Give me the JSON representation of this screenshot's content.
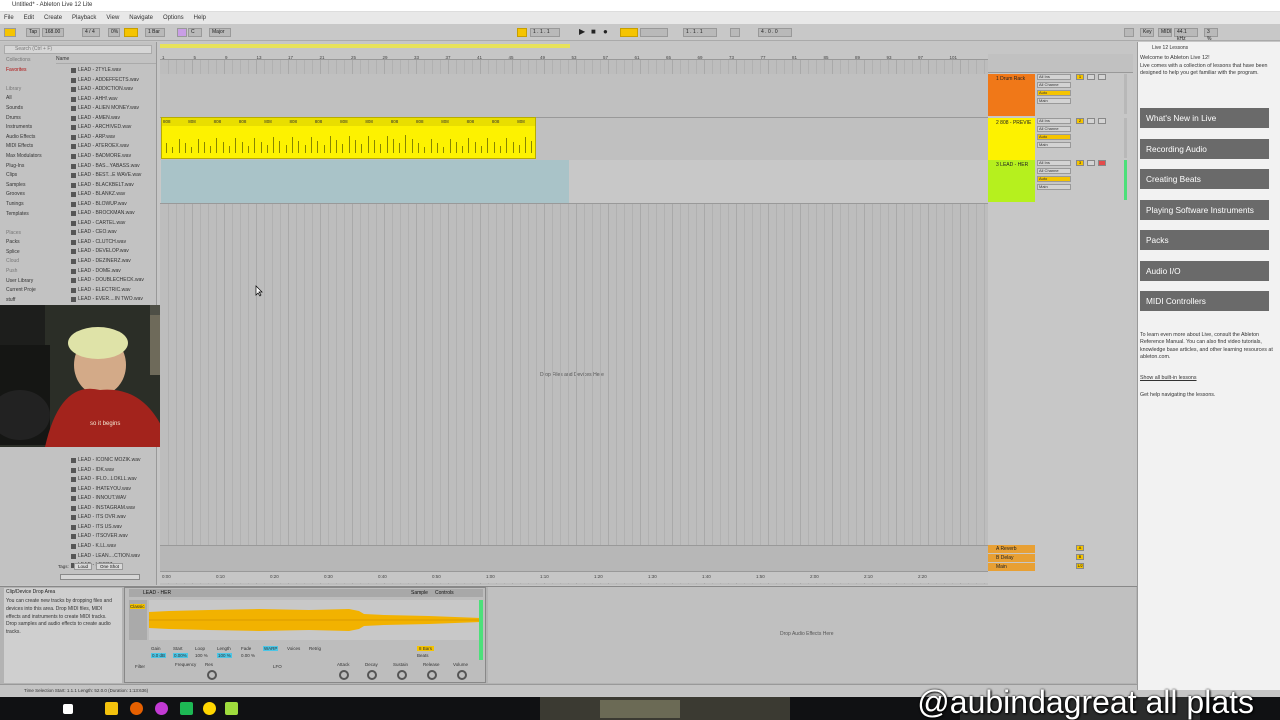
{
  "window": {
    "title": "Untitled* - Ableton Live 12 Lite",
    "min": "–",
    "max": "☐",
    "close": "✕"
  },
  "menu": [
    "File",
    "Edit",
    "Create",
    "Playback",
    "View",
    "Navigate",
    "Options",
    "Help"
  ],
  "toolbar": {
    "tap": "Tap",
    "tempo": "168.00",
    "sig": "4 / 4",
    "metro": "0%",
    "quant": "1 Bar",
    "key": "C",
    "scale": "Major",
    "pos": "1 . 1 . 1",
    "loop_start": "1 . 1 . 1",
    "loop_len": "4 . 0 . 0",
    "cpu": "3 %",
    "sample_rate": "44.1 kHz",
    "keyLabel": "Key",
    "midiLabel": "MIDI"
  },
  "browser": {
    "search_placeholder": "Search (Ctrl + F)",
    "name_header": "Name",
    "places": [
      {
        "label": "Collections",
        "type": "hdr"
      },
      {
        "label": "Favorites",
        "type": "fav"
      },
      {
        "label": "",
        "type": "sp"
      },
      {
        "label": "Library",
        "type": "hdr"
      },
      {
        "label": "All",
        "type": "n"
      },
      {
        "label": "Sounds",
        "type": "n"
      },
      {
        "label": "Drums",
        "type": "n"
      },
      {
        "label": "Instruments",
        "type": "n"
      },
      {
        "label": "Audio Effects",
        "type": "n"
      },
      {
        "label": "MIDI Effects",
        "type": "n"
      },
      {
        "label": "Max Modulators",
        "type": "n"
      },
      {
        "label": "Plug-Ins",
        "type": "n"
      },
      {
        "label": "Clips",
        "type": "n"
      },
      {
        "label": "Samples",
        "type": "n"
      },
      {
        "label": "Grooves",
        "type": "n"
      },
      {
        "label": "Tunings",
        "type": "n"
      },
      {
        "label": "Templates",
        "type": "n"
      },
      {
        "label": "",
        "type": "sp"
      },
      {
        "label": "Places",
        "type": "hdr"
      },
      {
        "label": "Packs",
        "type": "n"
      },
      {
        "label": "Splice",
        "type": "n"
      },
      {
        "label": "Cloud",
        "type": "hdr"
      },
      {
        "label": "Push",
        "type": "hdr"
      },
      {
        "label": "User Library",
        "type": "n"
      },
      {
        "label": "Current Proje",
        "type": "n"
      },
      {
        "label": "stuff",
        "type": "n"
      }
    ],
    "files_top": [
      "LEAD - 2TYLE.wav",
      "LEAD - ADDEFFECTS.wav",
      "LEAD - ADDICTION.wav",
      "LEAD - AHH!.wav",
      "LEAD - ALIEN MONEY.wav",
      "LEAD - AMEN.wav",
      "LEAD - ARCHIVED.wav",
      "LEAD - ARP.wav",
      "LEAD - ATEROEX.wav",
      "LEAD - BADMORE.wav",
      "LEAD - BAS...YABASS.wav",
      "LEAD - BEST...E WAVE.wav",
      "LEAD - BLACKBELT.wav",
      "LEAD - BLANKZ.wav",
      "LEAD - BLOWUP.wav",
      "LEAD - BROCKMAN.wav",
      "LEAD - CARTEL.wav",
      "LEAD - CEO.wav",
      "LEAD - CLUTCH.wav",
      "LEAD - DEVELOP.wav",
      "LEAD - DEZINERZ.wav",
      "LEAD - DOME.wav",
      "LEAD - DOUBLECHECK.wav",
      "LEAD - ELECTRIC.wav",
      "LEAD - EVER....IN TWO.wav"
    ],
    "files_bottom": [
      "LEAD - ICONIC MOZIK.wav",
      "LEAD - IDK.wav",
      "LEAD - IFLO...LOKLL.wav",
      "LEAD - IHATEYOU.wav",
      "LEAD - INNOUT.WAV",
      "LEAD - INSTAGRAM.wav",
      "LEAD - ITS OVR.wav",
      "LEAD - ITS US.wav",
      "LEAD - ITSOVER.wav",
      "LEAD - K.LL.wav",
      "LEAD - LEAN....CTION.wav",
      "LEAD - LOOPZ.wav"
    ],
    "tags_label": "Tags:",
    "tag1": "Loud",
    "tag2": "One Shot"
  },
  "webcam": {
    "shirt_text": "so it begins"
  },
  "arrangement": {
    "ruler_ticks": [
      "1",
      "5",
      "9",
      "13",
      "17",
      "21",
      "25",
      "29",
      "33",
      "37",
      "41",
      "45",
      "49",
      "53",
      "57",
      "61",
      "65",
      "69",
      "73",
      "77",
      "81",
      "85",
      "89",
      "93",
      "97",
      "101"
    ],
    "time_ticks": [
      "0:00",
      "0:10",
      "0:20",
      "0:30",
      "0:40",
      "0:50",
      "1:00",
      "1:10",
      "1:20",
      "1:30",
      "1:40",
      "1:50",
      "2:00",
      "2:10",
      "2:20"
    ],
    "clip_label": "808",
    "drop_text": "Drop Files and Devices Here"
  },
  "tracks": [
    {
      "name": "1 Drum Rack",
      "color": "#f07818",
      "input": "All Ins",
      "channel": "All Channe",
      "monitor": "Auto",
      "output": "Main",
      "num": "1"
    },
    {
      "name": "2 808 - PREVIE",
      "color": "#fdf200",
      "input": "All Ins",
      "channel": "All Channe",
      "monitor": "Auto",
      "output": "Main",
      "num": "2"
    },
    {
      "name": "3 LEAD - HER",
      "color": "#b6f01e",
      "input": "All Ins",
      "channel": "All Channe",
      "monitor": "Auto",
      "output": "Main",
      "num": "3"
    }
  ],
  "returns": [
    {
      "name": "A Reverb",
      "num": "A"
    },
    {
      "name": "B Delay",
      "num": "B"
    },
    {
      "name": "Main",
      "num": "1/2"
    }
  ],
  "help": {
    "panel_title": "Live 12 Lessons",
    "welcome": "Welcome to Ableton Live 12!",
    "intro": "Live comes with a collection of lessons that have been designed to help you get familiar with the program.",
    "lessons": [
      "What's New in Live",
      "Recording Audio",
      "Creating Beats",
      "Playing Software Instruments",
      "Packs",
      "Audio I/O",
      "MIDI Controllers"
    ],
    "footer1": "To learn even more about Live, consult the Ableton Reference Manual. You can also find video tutorials, knowledge base articles, and other learning resources at ableton.com.",
    "footer2": "Show all built-in lessons",
    "footer3": "Get help navigating the lessons."
  },
  "info": {
    "title": "Clip/Device Drop Area",
    "body": "You can create new tracks by dropping files and devices into this area. Drop MIDI files, MIDI effects and instruments to create MIDI tracks. Drop samples and audio effects to create audio tracks."
  },
  "clipview": {
    "name": "LEAD - HER",
    "tab_sample": "Sample",
    "tab_controls": "Controls",
    "gain": "Gain",
    "start": "Start",
    "loop": "Loop",
    "length": "Length",
    "fade": "Fade",
    "warp": "WARP",
    "gain_val": "0.0 dB",
    "start_val": "0.00%",
    "loop_val": "100 %",
    "len_val": "100 %",
    "fade_val": "0.00 %",
    "beats": "Beats",
    "bars": "8 Bars",
    "filter": "Filter",
    "freq": "Frequency",
    "res": "Res",
    "lfo": "LFO",
    "attack": "Attack",
    "decay": "Decay",
    "sustain": "Sustain",
    "release": "Release",
    "volume": "Volume",
    "voices": "Voices",
    "retrig": "Retrig",
    "classic": "Classic",
    "drop_fx": "Drop Audio Effects Here"
  },
  "status": {
    "text": "Time Selection   Start: 1.1.1   Length: 52.0.0 (Duration: 1:13:636)"
  },
  "taskbar": {
    "icons": [
      "windows",
      "file-explorer",
      "firefox",
      "obs",
      "spotify",
      "norton",
      "live"
    ]
  },
  "watermark": "@aubindagreat all plats"
}
